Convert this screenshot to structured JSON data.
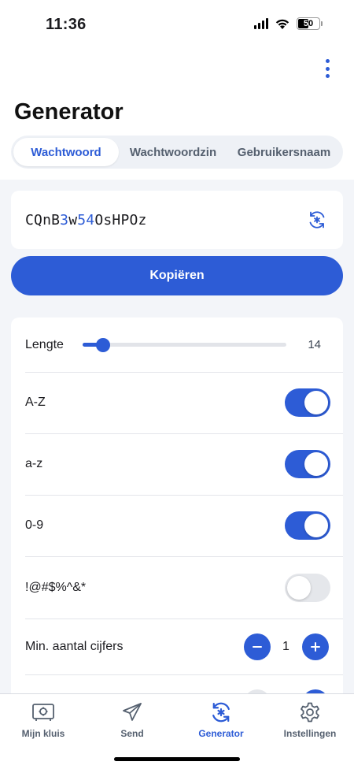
{
  "status_bar": {
    "time": "11:36",
    "battery": "50",
    "battery_level": 0.5
  },
  "header": {
    "title": "Generator"
  },
  "tabs": [
    {
      "label": "Wachtwoord",
      "active": true
    },
    {
      "label": "Wachtwoordzin",
      "active": false
    },
    {
      "label": "Gebruikersnaam",
      "active": false
    }
  ],
  "password": {
    "segments": [
      {
        "text": "CQnB",
        "numeric": false
      },
      {
        "text": "3",
        "numeric": true
      },
      {
        "text": "w",
        "numeric": false
      },
      {
        "text": "54",
        "numeric": true
      },
      {
        "text": "OsHPOz",
        "numeric": false
      }
    ]
  },
  "copy_button": {
    "label": "Kopiëren"
  },
  "options": {
    "length": {
      "label": "Lengte",
      "value": "14",
      "fraction": 0.1
    },
    "uppercase": {
      "label": "A-Z",
      "enabled": true
    },
    "lowercase": {
      "label": "a-z",
      "enabled": true
    },
    "numbers": {
      "label": "0-9",
      "enabled": true
    },
    "special": {
      "label": "!@#$%^&*",
      "enabled": false
    },
    "min_numbers": {
      "label": "Min. aantal cijfers",
      "value": "1"
    }
  },
  "bottom_nav": [
    {
      "label": "Mijn kluis",
      "icon": "vault-icon",
      "active": false
    },
    {
      "label": "Send",
      "icon": "send-icon",
      "active": false
    },
    {
      "label": "Generator",
      "icon": "generator-icon",
      "active": true
    },
    {
      "label": "Instellingen",
      "icon": "gear-icon",
      "active": false
    }
  ],
  "colors": {
    "accent": "#2d5cd6",
    "background": "#f3f5f9",
    "toggle_off": "#e5e7eb"
  }
}
